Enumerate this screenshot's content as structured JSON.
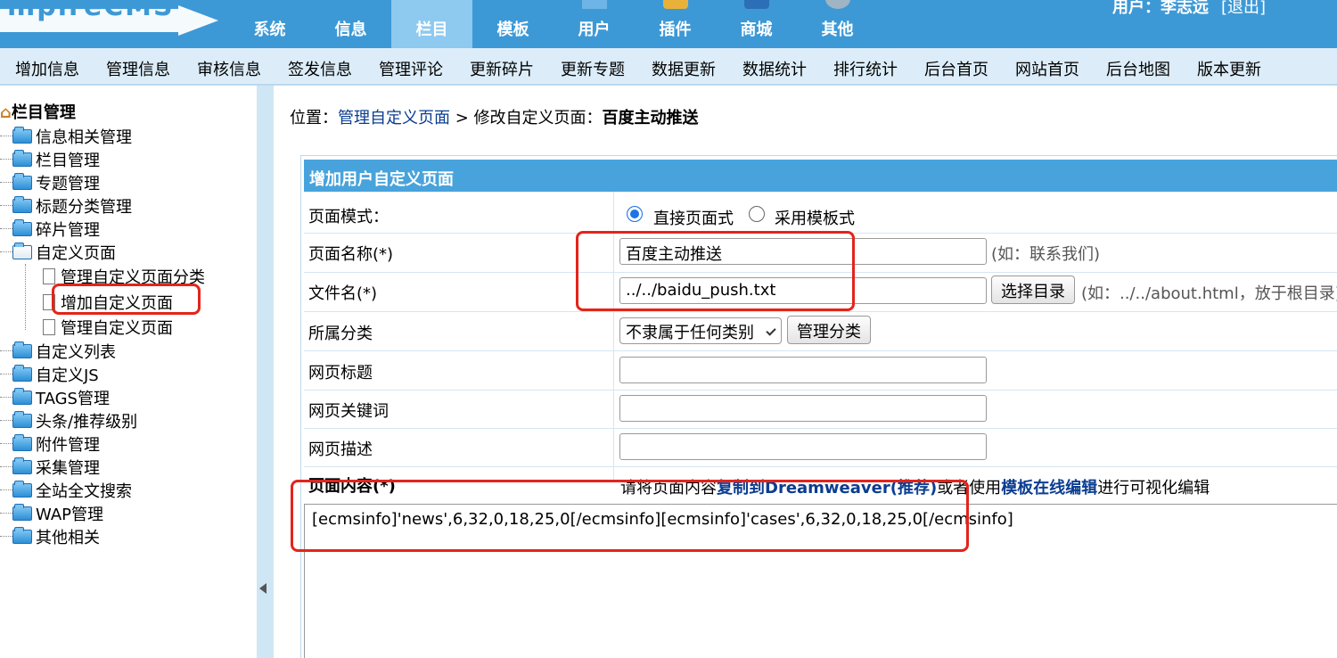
{
  "header": {
    "logo_text": "mpireCMS",
    "nav": [
      {
        "label": "系统",
        "active": false
      },
      {
        "label": "信息",
        "active": false
      },
      {
        "label": "栏目",
        "active": true
      },
      {
        "label": "模板",
        "active": false
      },
      {
        "label": "用户",
        "active": false
      },
      {
        "label": "插件",
        "active": false
      },
      {
        "label": "商城",
        "active": false
      },
      {
        "label": "其他",
        "active": false
      }
    ],
    "user_label": "用户：李志远",
    "logout_label": "[退出]"
  },
  "toolbar": {
    "items": [
      "增加信息",
      "管理信息",
      "审核信息",
      "签发信息",
      "管理评论",
      "更新碎片",
      "更新专题",
      "数据更新",
      "数据统计",
      "排行统计",
      "后台首页",
      "网站首页",
      "后台地图",
      "版本更新"
    ]
  },
  "sidebar": {
    "root": "栏目管理",
    "items": [
      "信息相关管理",
      "栏目管理",
      "专题管理",
      "标题分类管理",
      "碎片管理",
      "自定义页面"
    ],
    "sub_items": [
      "管理自定义页面分类",
      "增加自定义页面",
      "管理自定义页面"
    ],
    "items_after": [
      "自定义列表",
      "自定义JS",
      "TAGS管理",
      "头条/推荐级别",
      "附件管理",
      "采集管理",
      "全站全文搜索",
      "WAP管理",
      "其他相关"
    ]
  },
  "breadcrumb": {
    "prefix": "位置：",
    "link": "管理自定义页面",
    "separator": " > 修改自定义页面：",
    "current": "百度主动推送"
  },
  "form": {
    "title": "增加用户自定义页面",
    "mode_label": "页面模式：",
    "mode_options": [
      "直接页面式",
      "采用模板式"
    ],
    "mode_selected": 0,
    "name_label": "页面名称(*)",
    "name_value": "百度主动推送",
    "name_hint": "(如：联系我们)",
    "file_label": "文件名(*)",
    "file_value": "../../baidu_push.txt",
    "file_button": "选择目录",
    "file_hint": "(如：../../about.html，放于根目录)",
    "category_label": "所属分类",
    "category_value": "不隶属于任何类别",
    "category_button": "管理分类",
    "title_label": "网页标题",
    "title_value": "",
    "keywords_label": "网页关键词",
    "keywords_value": "",
    "desc_label": "网页描述",
    "desc_value": "",
    "content_label": "页面内容(*)",
    "content_hint_1": "请将页面内容",
    "content_hint_link1": "复制到Dreamweaver(推荐)",
    "content_hint_2": "或者使用",
    "content_hint_link2": "模板在线编辑",
    "content_hint_3": "进行可视化编辑",
    "content_value": "[ecmsinfo]'news',6,32,0,18,25,0[/ecmsinfo][ecmsinfo]'cases',6,32,0,18,25,0[/ecmsinfo]"
  },
  "colors": {
    "header_bg": "#3d99d6",
    "nav_active": "#8ec9ef",
    "toolbar_bg": "#dcedf9",
    "form_header": "#48a3dc",
    "highlight": "#e3241b"
  }
}
